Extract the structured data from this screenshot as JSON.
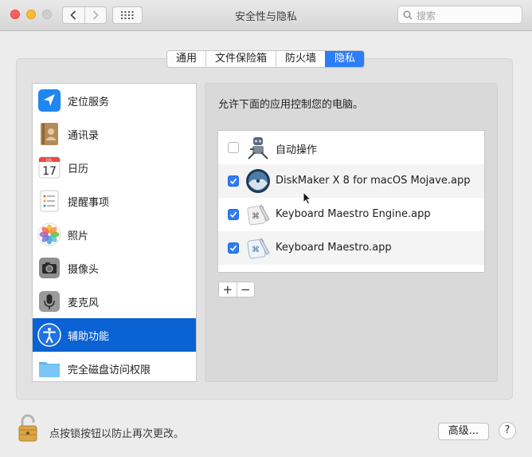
{
  "window": {
    "title": "安全性与隐私"
  },
  "search": {
    "placeholder": "搜索"
  },
  "tabs": [
    {
      "label": "通用",
      "active": false
    },
    {
      "label": "文件保险箱",
      "active": false
    },
    {
      "label": "防火墙",
      "active": false
    },
    {
      "label": "隐私",
      "active": true
    }
  ],
  "sidebar": {
    "items": [
      {
        "label": "定位服务",
        "icon": "location-arrow-icon"
      },
      {
        "label": "通讯录",
        "icon": "contacts-book-icon"
      },
      {
        "label": "日历",
        "icon": "calendar-icon",
        "day": "17",
        "month": "JUL"
      },
      {
        "label": "提醒事项",
        "icon": "reminders-list-icon"
      },
      {
        "label": "照片",
        "icon": "photos-flower-icon"
      },
      {
        "label": "摄像头",
        "icon": "camera-icon"
      },
      {
        "label": "麦克风",
        "icon": "microphone-icon"
      },
      {
        "label": "辅助功能",
        "icon": "accessibility-icon",
        "selected": true
      },
      {
        "label": "完全磁盘访问权限",
        "icon": "folder-icon"
      }
    ]
  },
  "main": {
    "header": "允许下面的应用控制您的电脑。",
    "apps": [
      {
        "name": "自动操作",
        "checked": false,
        "icon": "automator-robot-icon"
      },
      {
        "name": "DiskMaker X 8 for macOS Mojave.app",
        "checked": true,
        "icon": "mojave-disk-icon"
      },
      {
        "name": "Keyboard Maestro Engine.app",
        "checked": true,
        "icon": "keyboard-maestro-engine-icon"
      },
      {
        "name": "Keyboard Maestro.app",
        "checked": true,
        "icon": "keyboard-maestro-icon"
      }
    ],
    "add_label": "+",
    "remove_label": "−"
  },
  "footer": {
    "lock_text": "点按锁按钮以防止再次更改。",
    "advanced_label": "高级...",
    "help_label": "?"
  },
  "colors": {
    "accent": "#2e7cf6",
    "selection": "#0a62d3"
  }
}
